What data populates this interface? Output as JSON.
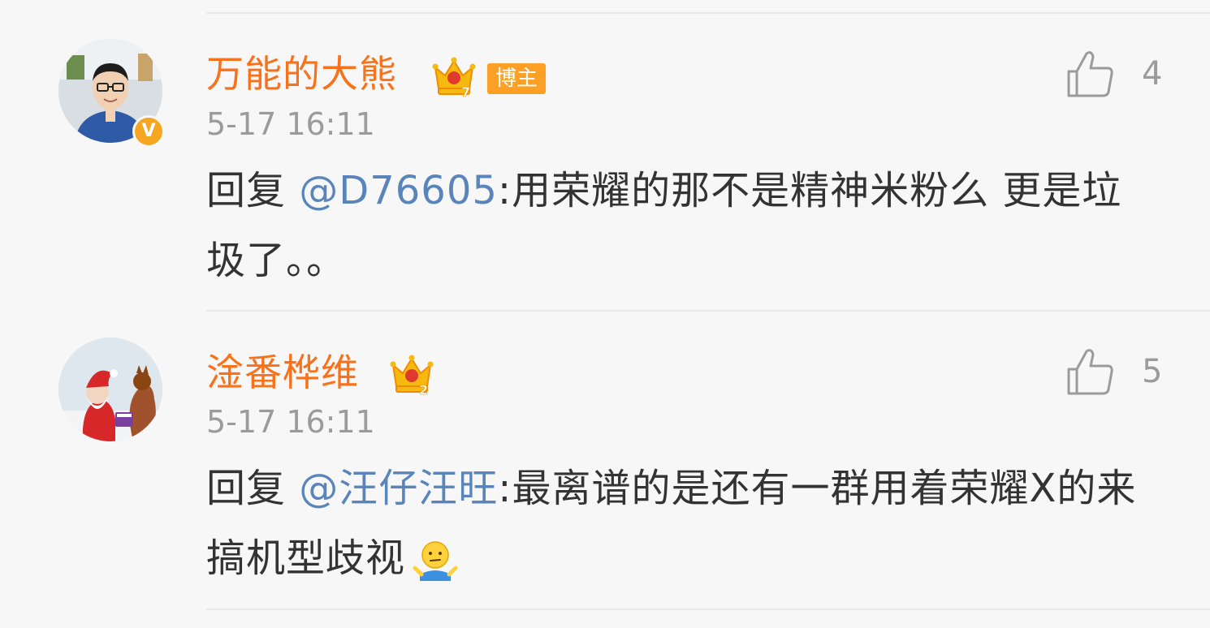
{
  "comments": [
    {
      "username": "万能的大熊",
      "crown_level": "7",
      "tag": "博主",
      "verified": "V",
      "time": "5-17 16:11",
      "likes": "4",
      "reply_prefix": "回复 ",
      "mention": "@D76605",
      "text": ":用荣耀的那不是精神米粉么 更是垃圾了。。"
    },
    {
      "username": "淦番桦维",
      "crown_level": "2",
      "time": "5-17 16:11",
      "likes": "5",
      "reply_prefix": "回复 ",
      "mention": "@汪仔汪旺",
      "text": ":最离谱的是还有一群用着荣耀X的来搞机型歧视",
      "emoji": "shrug-emoji"
    }
  ],
  "colors": {
    "username": "#f8711b",
    "mention": "#5a85ba",
    "meta": "#9b9b9b",
    "text": "#333333",
    "background": "#f7f7f7"
  }
}
